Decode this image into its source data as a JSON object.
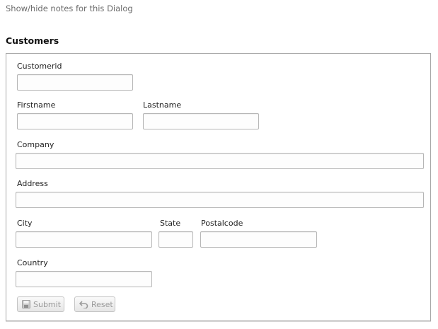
{
  "notes_link": "Show/hide notes for this Dialog",
  "section_title": "Customers",
  "form": {
    "customerid": {
      "label": "Customerid",
      "value": ""
    },
    "firstname": {
      "label": "Firstname",
      "value": ""
    },
    "lastname": {
      "label": "Lastname",
      "value": ""
    },
    "company": {
      "label": "Company",
      "value": ""
    },
    "address": {
      "label": "Address",
      "value": ""
    },
    "city": {
      "label": "City",
      "value": ""
    },
    "state": {
      "label": "State",
      "value": ""
    },
    "postalcode": {
      "label": "Postalcode",
      "value": ""
    },
    "country": {
      "label": "Country",
      "value": ""
    }
  },
  "buttons": {
    "submit": {
      "label": "Submit",
      "icon": "save-icon",
      "disabled": true
    },
    "reset": {
      "label": "Reset",
      "icon": "undo-icon",
      "disabled": true
    }
  },
  "colors": {
    "border": "#a8a8a8",
    "field_border": "#b5b5b5",
    "disabled_text": "#9a9a9a"
  }
}
